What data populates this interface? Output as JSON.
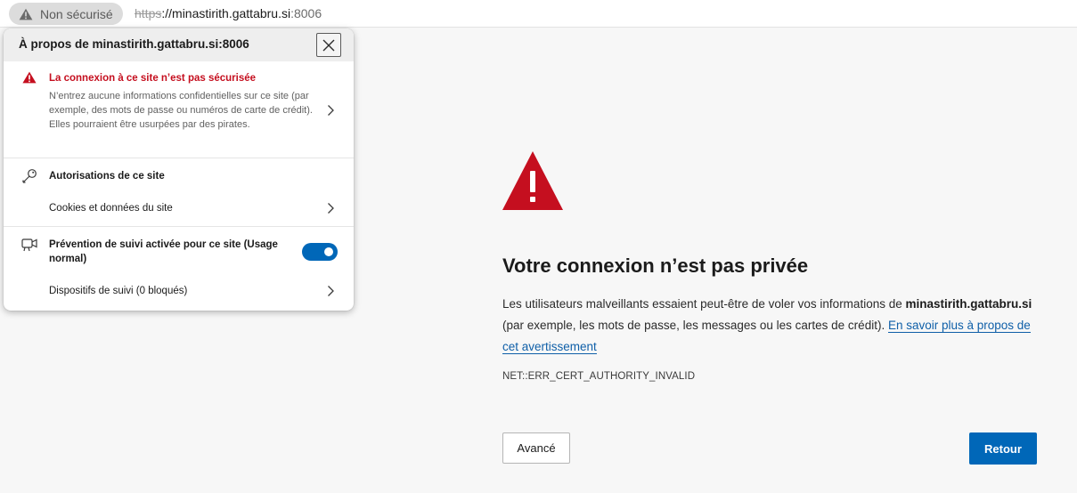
{
  "addressbar": {
    "security_label": "Non sécurisé",
    "url_scheme": "https",
    "url_separator": "://",
    "url_host": "minastirith.gattabru.si",
    "url_port": ":8006"
  },
  "popup": {
    "title": "À propos de minastirith.gattabru.si:8006",
    "warning_heading": "La connexion à ce site n’est pas sécurisée",
    "warning_body": "N’entrez aucune informations confidentielles sur ce site (par exemple, des mots de passe ou numéros de carte de crédit). Elles pourraient être usurpées par des pirates.",
    "permissions_label": "Autorisations de ce site",
    "cookies_label": "Cookies et données du site",
    "tracking_label": "Prévention de suivi activée pour ce site (Usage normal)",
    "tracking_enabled": true,
    "trackers_label": "Dispositifs de suivi (0 bloqués)"
  },
  "error_page": {
    "title": "Votre connexion n’est pas privée",
    "desc_before": "Les utilisateurs malveillants essaient peut-être de voler vos informations de ",
    "desc_host": "minastirith.gattabru.si",
    "desc_after": " (par exemple, les mots de passe, les messages ou les cartes de crédit). ",
    "learn_more": "En savoir plus à propos de cet avertissement",
    "error_code": "NET::ERR_CERT_AUTHORITY_INVALID",
    "advanced_button": "Avancé",
    "back_button": "Retour"
  },
  "colors": {
    "accent": "#0067b8",
    "danger": "#c50f1f",
    "warning_triangle": "#c50f1f",
    "link": "#0f5fa8"
  },
  "icons": {
    "security_chip": "warning-triangle-icon",
    "popup_close": "close-icon",
    "warning": "warning-triangle-icon",
    "permissions": "key-icon",
    "tracking": "camera-icon",
    "chevron": "chevron-right-icon",
    "page_warning": "warning-triangle-icon"
  }
}
